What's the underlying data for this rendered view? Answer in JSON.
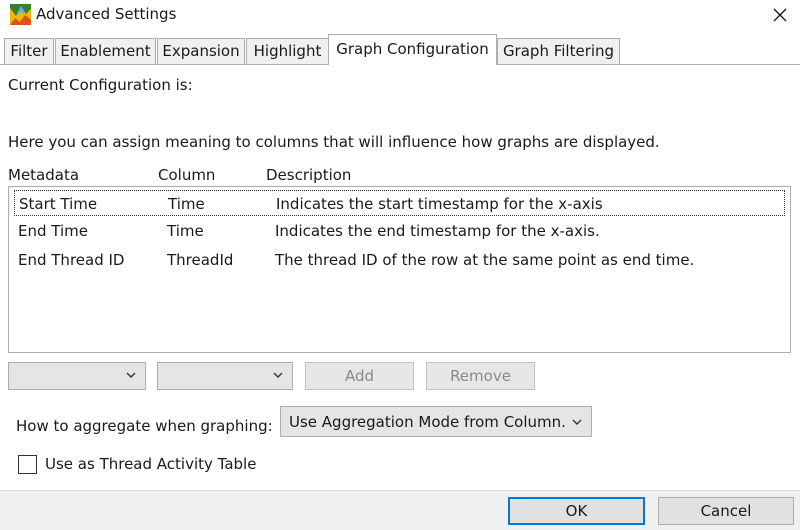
{
  "window": {
    "title": "Advanced Settings",
    "icon": "graph-app-icon",
    "close_icon": "close-icon"
  },
  "tabs": [
    {
      "label": "Filter",
      "active": false
    },
    {
      "label": "Enablement",
      "active": false
    },
    {
      "label": "Expansion",
      "active": false
    },
    {
      "label": "Highlight",
      "active": false
    },
    {
      "label": "Graph Configuration",
      "active": true
    },
    {
      "label": "Graph Filtering",
      "active": false
    }
  ],
  "content": {
    "current_config_label": "Current Configuration is:",
    "intro_text": "Here you can assign meaning to columns that will influence how graphs are displayed.",
    "columns": {
      "metadata": "Metadata",
      "column": "Column",
      "description": "Description"
    },
    "rows": [
      {
        "metadata": "Start Time",
        "column": "Time",
        "description": "Indicates the start timestamp for the x-axis"
      },
      {
        "metadata": "End Time",
        "column": "Time",
        "description": "Indicates the end timestamp for the x-axis."
      },
      {
        "metadata": "End Thread ID",
        "column": "ThreadId",
        "description": "The thread ID of the row at the same point as end time."
      }
    ],
    "metadata_combo_value": "",
    "column_combo_value": "",
    "add_label": "Add",
    "remove_label": "Remove",
    "aggregate_label": "How to aggregate when graphing:",
    "aggregate_value": "Use Aggregation Mode from Column.",
    "thread_activity_label": "Use as Thread Activity Table",
    "thread_activity_checked": false
  },
  "footer": {
    "ok_label": "OK",
    "cancel_label": "Cancel"
  },
  "colors": {
    "accent": "#0078d7",
    "border": "#adadad",
    "tab_bg": "#f0f0f0"
  }
}
